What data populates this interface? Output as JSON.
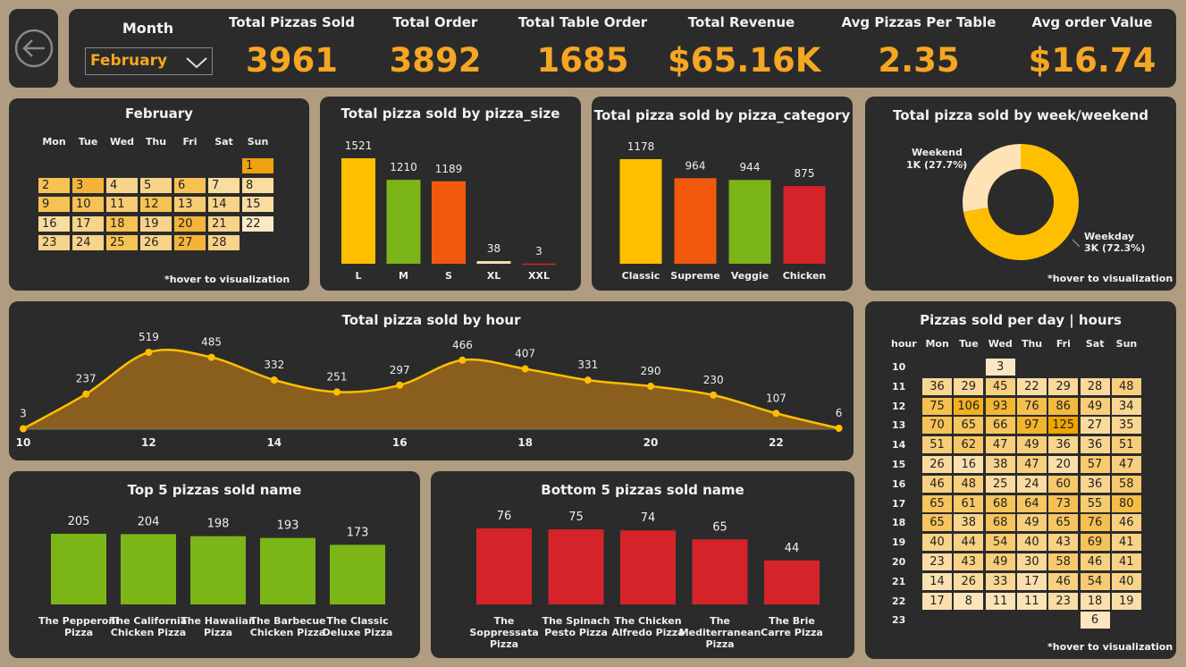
{
  "header": {
    "month_label": "Month",
    "month_value": "February",
    "kpis": [
      {
        "label": "Total Pizzas Sold",
        "value": "3961"
      },
      {
        "label": "Total Order",
        "value": "3892"
      },
      {
        "label": "Total Table Order",
        "value": "1685"
      },
      {
        "label": "Total Revenue",
        "value": "$65.16K"
      },
      {
        "label": "Avg Pizzas Per Table",
        "value": "2.35"
      },
      {
        "label": "Avg order Value",
        "value": "$16.74"
      }
    ]
  },
  "calendar": {
    "title": "February",
    "weekdays": [
      "Mon",
      "Tue",
      "Wed",
      "Thu",
      "Fri",
      "Sat",
      "Sun"
    ],
    "days": [
      "1",
      "2",
      "3",
      "4",
      "5",
      "6",
      "7",
      "8",
      "9",
      "10",
      "11",
      "12",
      "13",
      "14",
      "15",
      "16",
      "17",
      "18",
      "19",
      "20",
      "21",
      "22",
      "23",
      "24",
      "25",
      "26",
      "27",
      "28"
    ],
    "hover_note": "*hover to visualization"
  },
  "colors": {
    "orange": "#f5a623",
    "yellow": "#ffbf00",
    "green": "#7cb518",
    "red_orange": "#f15a0e",
    "red": "#d4242a",
    "beige": "#f9dfb0",
    "panel": "#2b2b2b",
    "background": "#b09c80"
  },
  "chart_data": [
    {
      "type": "bar",
      "title": "Total pizza sold by pizza_size",
      "categories": [
        "L",
        "M",
        "S",
        "XL",
        "XXL"
      ],
      "values": [
        1521,
        1210,
        1189,
        38,
        3
      ],
      "value_labels": [
        "1521",
        "1210",
        "1189",
        "38",
        "3"
      ],
      "colors": [
        "#ffbf00",
        "#7cb518",
        "#f15a0e",
        "#f9dfb0",
        "#d4242a"
      ]
    },
    {
      "type": "bar",
      "title": "Total pizza sold by pizza_category",
      "categories": [
        "Classic",
        "Supreme",
        "Veggie",
        "Chicken"
      ],
      "values": [
        1178,
        964,
        944,
        875
      ],
      "value_labels": [
        "1178",
        "964",
        "944",
        "875"
      ],
      "colors": [
        "#ffbf00",
        "#f15a0e",
        "#7cb518",
        "#d4242a"
      ]
    },
    {
      "type": "pie",
      "title": "Total pizza sold by week/weekend",
      "labels": [
        "Weekday",
        "Weekend"
      ],
      "values": [
        72.3,
        27.7
      ],
      "value_labels": [
        "3K (72.3%)",
        "1K (27.7%)"
      ],
      "colors": [
        "#ffbf00",
        "#fde3b5"
      ],
      "hover_note": "*hover to visualization"
    },
    {
      "type": "area",
      "title": "Total pizza sold by hour",
      "x": [
        10,
        11,
        12,
        13,
        14,
        15,
        16,
        17,
        18,
        19,
        20,
        21,
        22,
        23
      ],
      "y": [
        3,
        237,
        519,
        485,
        332,
        251,
        297,
        466,
        407,
        331,
        290,
        230,
        107,
        6
      ],
      "x_ticks": [
        "10",
        "12",
        "14",
        "16",
        "18",
        "20",
        "22"
      ],
      "value_labels": [
        "3",
        "237",
        "519",
        "485",
        "332",
        "251",
        "297",
        "466",
        "407",
        "331",
        "290",
        "230",
        "107",
        "6"
      ]
    },
    {
      "type": "heatmap",
      "title": "Pizzas sold per day | hours",
      "corner_label": "hour",
      "columns": [
        "Mon",
        "Tue",
        "Wed",
        "Thu",
        "Fri",
        "Sat",
        "Sun"
      ],
      "rows": [
        "10",
        "11",
        "12",
        "13",
        "14",
        "15",
        "16",
        "17",
        "18",
        "19",
        "20",
        "21",
        "22",
        "23"
      ],
      "cells": [
        [
          "",
          "",
          "3",
          "",
          "",
          "",
          ""
        ],
        [
          "36",
          "29",
          "45",
          "22",
          "29",
          "28",
          "48"
        ],
        [
          "75",
          "106",
          "93",
          "76",
          "86",
          "49",
          "34"
        ],
        [
          "70",
          "65",
          "66",
          "97",
          "125",
          "27",
          "35"
        ],
        [
          "51",
          "62",
          "47",
          "49",
          "36",
          "36",
          "51"
        ],
        [
          "26",
          "16",
          "38",
          "47",
          "20",
          "57",
          "47"
        ],
        [
          "46",
          "48",
          "25",
          "24",
          "60",
          "36",
          "58"
        ],
        [
          "65",
          "61",
          "68",
          "64",
          "73",
          "55",
          "80"
        ],
        [
          "65",
          "38",
          "68",
          "49",
          "65",
          "76",
          "46"
        ],
        [
          "40",
          "44",
          "54",
          "40",
          "43",
          "69",
          "41"
        ],
        [
          "23",
          "43",
          "49",
          "30",
          "58",
          "46",
          "41"
        ],
        [
          "14",
          "26",
          "33",
          "17",
          "46",
          "54",
          "40"
        ],
        [
          "17",
          "8",
          "11",
          "11",
          "23",
          "18",
          "19"
        ],
        [
          "",
          "",
          "",
          "",
          "",
          "6",
          ""
        ]
      ],
      "hover_note": "*hover to visualization"
    },
    {
      "type": "bar",
      "title": "Top 5 pizzas sold name",
      "categories": [
        "The Pepperoni Pizza",
        "The California Chicken Pizza",
        "The Hawaiian Pizza",
        "The Barbecue Chicken Pizza",
        "The Classic Deluxe Pizza"
      ],
      "values": [
        205,
        204,
        198,
        193,
        173
      ],
      "value_labels": [
        "205",
        "204",
        "198",
        "193",
        "173"
      ],
      "colors": [
        "#7cb518"
      ]
    },
    {
      "type": "bar",
      "title": "Bottom 5 pizzas sold name",
      "categories": [
        "The Soppressata Pizza",
        "The Spinach Pesto Pizza",
        "The Chicken Alfredo Pizza",
        "The Mediterranean Pizza",
        "The Brie Carre Pizza"
      ],
      "values": [
        76,
        75,
        74,
        65,
        44
      ],
      "value_labels": [
        "76",
        "75",
        "74",
        "65",
        "44"
      ],
      "colors": [
        "#d4242a"
      ]
    }
  ]
}
